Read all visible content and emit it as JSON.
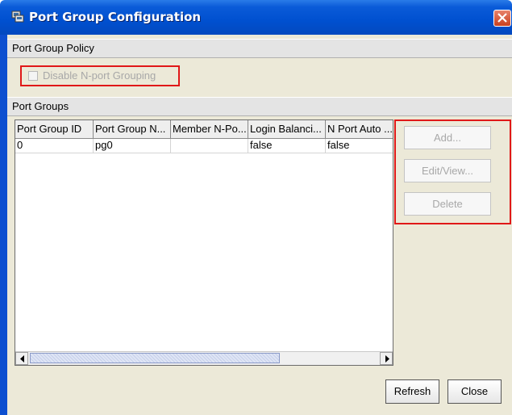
{
  "window": {
    "title": "Port Group Configuration",
    "app_icon": "computer-icon",
    "close_icon": "close-icon"
  },
  "policy": {
    "header": "Port Group Policy",
    "disable_checkbox": {
      "label": "Disable N-port Grouping",
      "checked": false,
      "enabled": false
    }
  },
  "groups": {
    "header": "Port Groups",
    "columns": [
      "Port Group ID",
      "Port Group N...",
      "Member N-Po...",
      "Login Balanci...",
      "N Port Auto ..."
    ],
    "rows": [
      [
        "0",
        "pg0",
        "",
        "false",
        "false"
      ]
    ],
    "scroll_left_icon": "arrow-left-icon",
    "scroll_right_icon": "arrow-right-icon"
  },
  "side_buttons": {
    "add": "Add...",
    "edit": "Edit/View...",
    "delete": "Delete"
  },
  "footer": {
    "refresh": "Refresh",
    "close": "Close"
  },
  "colors": {
    "title_bar": "#0050d0",
    "highlight_box": "#e01818",
    "disabled_text": "#a8a8a8"
  }
}
